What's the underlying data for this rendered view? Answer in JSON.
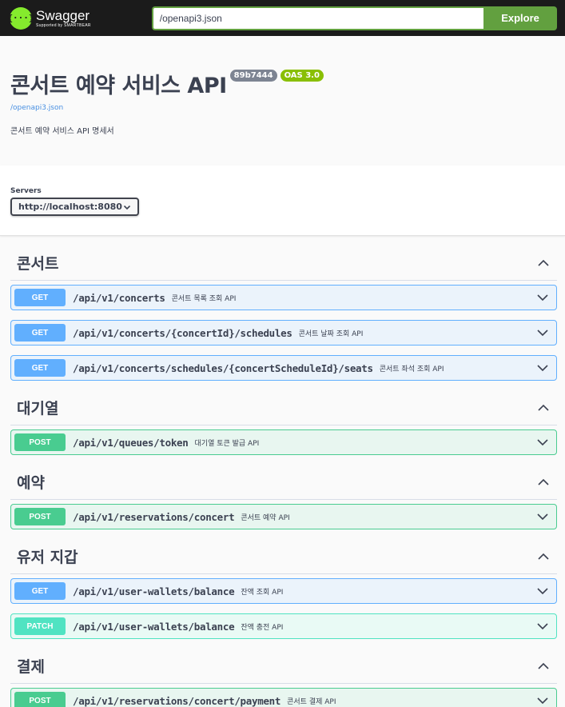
{
  "topbar": {
    "logo_mark": "{···}",
    "logo_name": "Swagger",
    "logo_sub": "Supported by SMARTBEAR",
    "url_value": "/openapi3.json",
    "explore_label": "Explore"
  },
  "info": {
    "title": "콘서트 예약 서비스 API",
    "version_badge": "89b7444",
    "oas_badge": "OAS 3.0",
    "spec_link": "/openapi3.json",
    "description": "콘서트 예약 서비스 API 명세서"
  },
  "servers": {
    "label": "Servers",
    "selected": "http://localhost:8080"
  },
  "tags": [
    {
      "name": "콘서트",
      "operations": [
        {
          "method": "GET",
          "path": "/api/v1/concerts",
          "summary": "콘서트 목록 조회 API"
        },
        {
          "method": "GET",
          "path": "/api/v1/concerts/{concertId}/schedules",
          "summary": "콘서트 날짜 조회 API"
        },
        {
          "method": "GET",
          "path": "/api/v1/concerts/schedules/{concertScheduleId}/seats",
          "summary": "콘서트 좌석 조회 API"
        }
      ]
    },
    {
      "name": "대기열",
      "operations": [
        {
          "method": "POST",
          "path": "/api/v1/queues/token",
          "summary": "대기열 토큰 발급 API"
        }
      ]
    },
    {
      "name": "예약",
      "operations": [
        {
          "method": "POST",
          "path": "/api/v1/reservations/concert",
          "summary": "콘서트 예약 API"
        }
      ]
    },
    {
      "name": "유저 지갑",
      "operations": [
        {
          "method": "GET",
          "path": "/api/v1/user-wallets/balance",
          "summary": "잔액 조회 API"
        },
        {
          "method": "PATCH",
          "path": "/api/v1/user-wallets/balance",
          "summary": "잔액 충전 API"
        }
      ]
    },
    {
      "name": "결제",
      "operations": [
        {
          "method": "POST",
          "path": "/api/v1/reservations/concert/payment",
          "summary": "콘서트 결제 API"
        }
      ]
    }
  ],
  "colors": {
    "get": "#61affe",
    "post": "#49cc90",
    "patch": "#50e3c2",
    "explore": "#62a03f",
    "topbar": "#1b1b1b"
  }
}
